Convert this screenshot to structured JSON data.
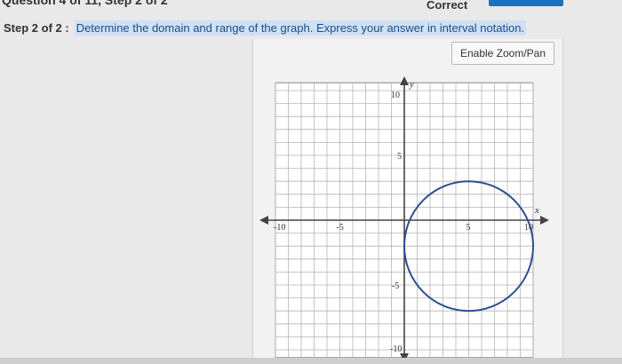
{
  "header": {
    "clipped_title": "Question 4 of 11, Step 2 of 2",
    "status": "Correct",
    "accent_color": "#1e73b8"
  },
  "step": {
    "label": "Step 2 of 2 :",
    "question": "Determine the domain and range of the graph. Express your answer in interval notation."
  },
  "toolbar": {
    "zoom_label": "Enable Zoom/Pan"
  },
  "chart_data": {
    "type": "scatter",
    "xlim": [
      -10,
      10
    ],
    "ylim": [
      -10,
      10
    ],
    "grid": true,
    "x_axis_label": "x",
    "y_axis_label": "y",
    "x_tick_labels": [
      "-10",
      "-5",
      "5",
      "10"
    ],
    "y_tick_labels": [
      "10",
      "5",
      "-5",
      "-10"
    ],
    "circle": {
      "center": [
        5,
        -2
      ],
      "radius": 5,
      "color": "#2a4f8f"
    }
  }
}
